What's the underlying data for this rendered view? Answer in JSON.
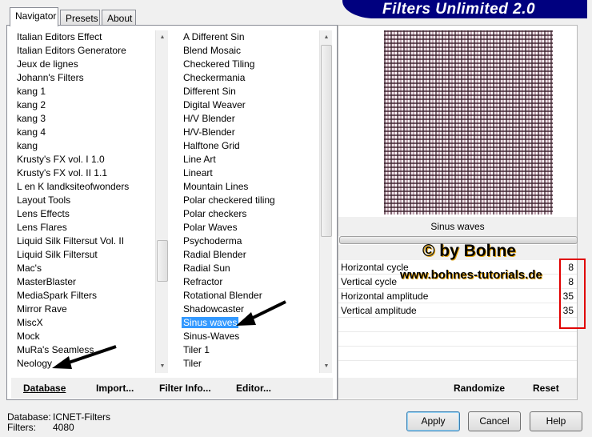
{
  "banner": {
    "title": "Filters Unlimited 2.0"
  },
  "tabs": [
    {
      "label": "Navigator",
      "active": true
    },
    {
      "label": "Presets"
    },
    {
      "label": "About"
    }
  ],
  "categories": [
    "Italian Editors Effect",
    "Italian Editors Generatore",
    "Jeux de lignes",
    "Johann's Filters",
    "kang 1",
    "kang 2",
    "kang 3",
    "kang 4",
    "kang",
    "Krusty's FX vol. I 1.0",
    "Krusty's FX vol. II 1.1",
    "L en K landksiteofwonders",
    "Layout Tools",
    "Lens Effects",
    "Lens Flares",
    "Liquid Silk Filtersut Vol. II",
    "Liquid Silk Filtersut",
    "Mac's",
    "MasterBlaster",
    "MediaSpark Filters",
    "Mirror Rave",
    "MiscX",
    "Mock",
    "MuRa's Seamless",
    "Neology"
  ],
  "filters": [
    "A Different Sin",
    "Blend Mosaic",
    "Checkered Tiling",
    "Checkermania",
    "Different Sin",
    "Digital Weaver",
    "H/V Blender",
    "H/V-Blender",
    "Halftone Grid",
    "Line Art",
    "Lineart",
    "Mountain Lines",
    "Polar checkered tiling",
    "Polar checkers",
    "Polar Waves",
    "Psychoderma",
    "Radial Blender",
    "Radial Sun",
    "Refractor",
    "Rotational Blender",
    "Shadowcaster",
    "Sinus waves",
    "Sinus-Waves",
    "Tiler 1",
    "Tiler"
  ],
  "selected_filter": "Sinus waves",
  "buttons": {
    "database": "Database",
    "import": "Import...",
    "filter_info": "Filter Info...",
    "editor": "Editor...",
    "randomize": "Randomize",
    "reset": "Reset",
    "apply": "Apply",
    "cancel": "Cancel",
    "help": "Help"
  },
  "preview": {
    "filter_name": "Sinus waves"
  },
  "params": [
    {
      "label": "Horizontal cycle",
      "value": "8"
    },
    {
      "label": "Vertical cycle",
      "value": "8"
    },
    {
      "label": "Horizontal amplitude",
      "value": "35"
    },
    {
      "label": "Vertical amplitude",
      "value": "35"
    }
  ],
  "watermark": {
    "line1": "© by Bohne",
    "line2": "www.bohnes-tutorials.de"
  },
  "status": {
    "database_label": "Database:",
    "database_value": "ICNET-Filters",
    "filters_label": "Filters:",
    "filters_value": "4080"
  },
  "colors": {
    "banner": "#00007f",
    "selection": "#3399ff",
    "highlight_box": "#e00000"
  }
}
